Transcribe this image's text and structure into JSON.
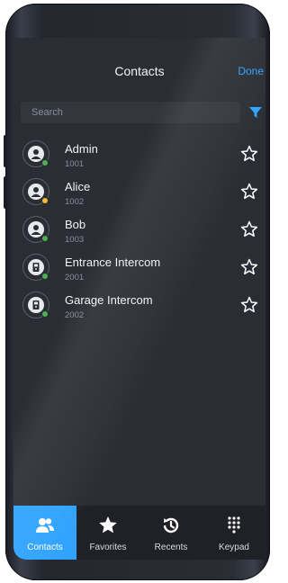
{
  "header": {
    "title": "Contacts",
    "done_label": "Done"
  },
  "search": {
    "placeholder": "Search"
  },
  "contacts": [
    {
      "name": "Admin",
      "number": "1001",
      "type": "user",
      "status_color": "#4caf50"
    },
    {
      "name": "Alice",
      "number": "1002",
      "type": "user",
      "status_color": "#f5b82e"
    },
    {
      "name": "Bob",
      "number": "1003",
      "type": "user",
      "status_color": "#4caf50"
    },
    {
      "name": "Entrance Intercom",
      "number": "2001",
      "type": "intercom",
      "status_color": "#4caf50"
    },
    {
      "name": "Garage Intercom",
      "number": "2002",
      "type": "intercom",
      "status_color": "#4caf50"
    }
  ],
  "tabs": [
    {
      "label": "Contacts",
      "icon": "contacts-icon",
      "active": true
    },
    {
      "label": "Favorites",
      "icon": "star-icon",
      "active": false
    },
    {
      "label": "Recents",
      "icon": "recents-icon",
      "active": false
    },
    {
      "label": "Keypad",
      "icon": "keypad-icon",
      "active": false
    }
  ],
  "colors": {
    "accent": "#2fa3ff",
    "background": "#2a2d33",
    "tabbar": "#1f2126"
  }
}
